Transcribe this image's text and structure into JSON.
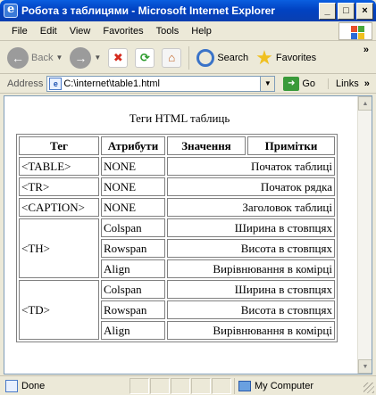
{
  "window": {
    "title": "Робота з таблицями - Microsoft Internet Explorer",
    "controls": [
      "_",
      "□",
      "×"
    ]
  },
  "menu": [
    "File",
    "Edit",
    "View",
    "Favorites",
    "Tools",
    "Help"
  ],
  "toolbar": {
    "back_label": "Back",
    "search_label": "Search",
    "favorites_label": "Favorites",
    "more": "»"
  },
  "address": {
    "label": "Address",
    "value": "C:\\internet\\table1.html",
    "go_label": "Go",
    "links_label": "Links",
    "links_more": "»"
  },
  "page": {
    "caption": "Теги HTML таблиць",
    "headers": [
      "Тег",
      "Атрибути",
      "Значення",
      "Примітки"
    ],
    "simple_rows": [
      {
        "tag": "<TABLE>",
        "attr": "NONE",
        "note": "Початок таблиці"
      },
      {
        "tag": "<TR>",
        "attr": "NONE",
        "note": "Початок рядка"
      },
      {
        "tag": "<CAPTION>",
        "attr": "NONE",
        "note": "Заголовок таблиці"
      }
    ],
    "groups": [
      {
        "tag": "<TH>",
        "rows": [
          {
            "attr": "Colspan",
            "note": "Ширина в стовпцях"
          },
          {
            "attr": "Rowspan",
            "note": "Висота в стовпцях"
          },
          {
            "attr": "Align",
            "note": "Вирівнювання в комірці"
          }
        ]
      },
      {
        "tag": "<TD>",
        "rows": [
          {
            "attr": "Colspan",
            "note": "Ширина в стовпцях"
          },
          {
            "attr": "Rowspan",
            "note": "Висота в стовпцях"
          },
          {
            "attr": "Align",
            "note": "Вирівнювання в комірці"
          }
        ]
      }
    ]
  },
  "status": {
    "text": "Done",
    "zone": "My Computer"
  }
}
